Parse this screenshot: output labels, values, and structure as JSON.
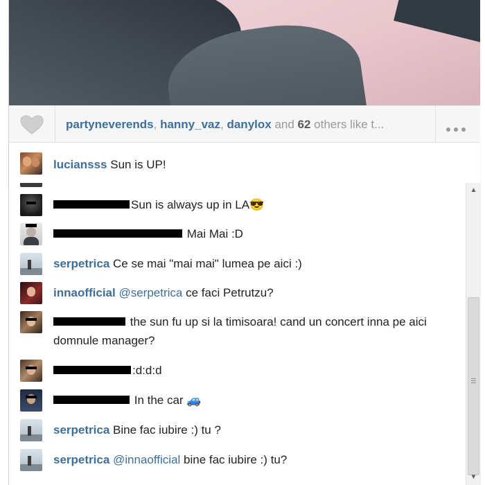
{
  "likes": {
    "users": [
      "partyneverends",
      "hanny_vaz",
      "danylox"
    ],
    "sep1": ", ",
    "sep2": ", ",
    "and_text": " and ",
    "count": "62",
    "tail": " others like t..."
  },
  "caption": {
    "username": "luciansss",
    "text": "Sun is UP!"
  },
  "comments": [
    {
      "username": "",
      "text": "Sun is always up in LA😎",
      "redacted": true
    },
    {
      "username": "",
      "text": " Mai Mai :D",
      "redacted": true
    },
    {
      "username": "serpetrica",
      "text": "Ce se mai \"mai mai\" lumea pe aici :)"
    },
    {
      "username": "innaofficial",
      "mention": "@serpetrica",
      "text": " ce faci Petrutzu?"
    },
    {
      "username": "",
      "text": " the sun fu up si la timisoara! cand un concert inna pe aici domnule manager?",
      "redacted": true
    },
    {
      "username": "",
      "text": ":d:d:d",
      "redacted": true
    },
    {
      "username": "",
      "text": " In the car 🚙",
      "redacted": true
    },
    {
      "username": "serpetrica",
      "text": "Bine fac iubire :) tu ?"
    },
    {
      "username": "serpetrica",
      "mention": "@innaofficial",
      "text": " bine fac iubire :) tu?"
    }
  ],
  "icons": {
    "like": "heart-icon",
    "more": "more-dots-icon",
    "scroll_up": "scroll-up-arrow-icon",
    "scroll_down": "scroll-down-arrow-icon"
  },
  "colors": {
    "username": "#3f6f99",
    "likes_bar": "#f6f6f6",
    "redaction": "#000000"
  }
}
